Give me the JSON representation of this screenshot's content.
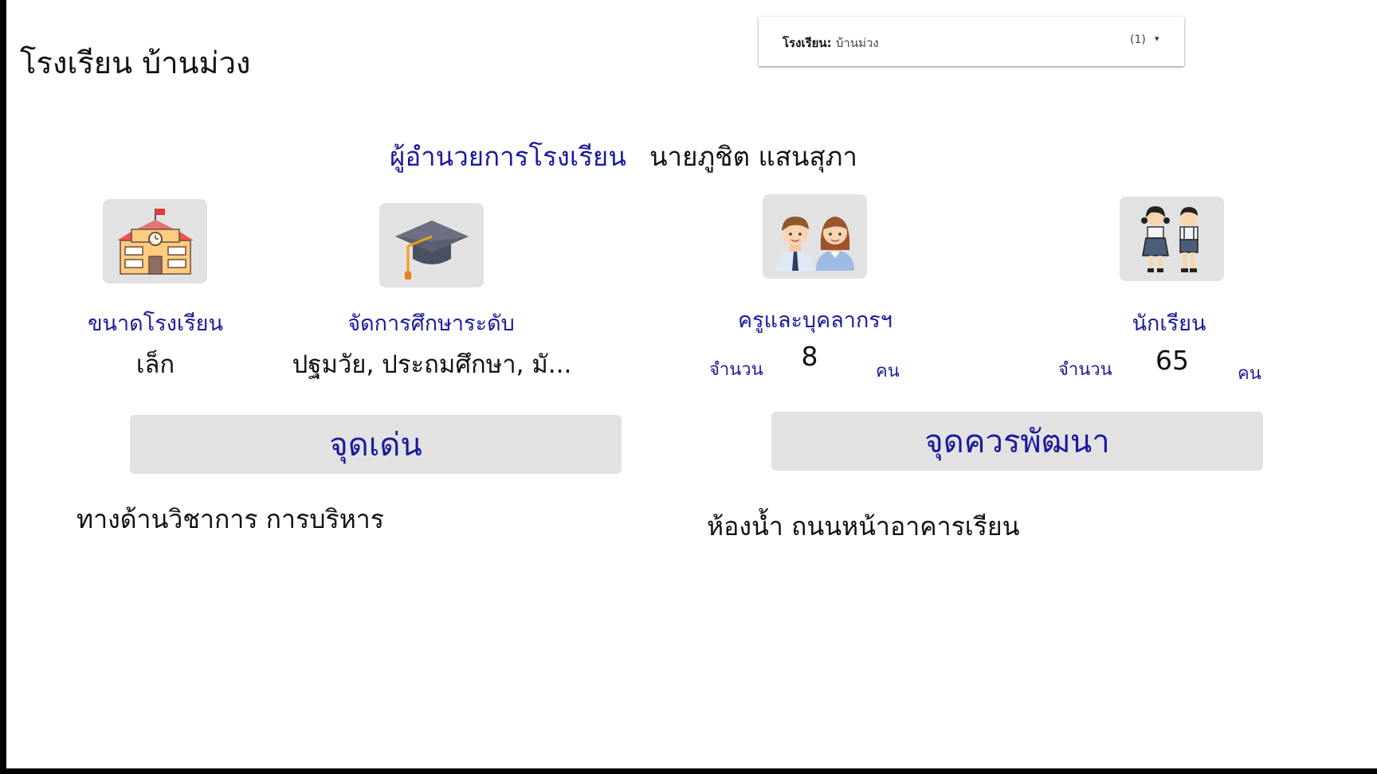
{
  "header": {
    "title": "โรงเรียน บ้านม่วง"
  },
  "filter": {
    "label": "โรงเรียน",
    "value": "บ้านม่วง",
    "count": "(1)",
    "caret": "▾"
  },
  "director": {
    "label": "ผู้อำนวยการโรงเรียน",
    "name": "นายภูชิต แสนสุภา"
  },
  "cards": {
    "size": {
      "icon": "school-building-icon",
      "label": "ขนาดโรงเรียน",
      "value": "เล็ก"
    },
    "level": {
      "icon": "graduation-cap-icon",
      "label": "จัดการศึกษาระดับ",
      "value": "ปฐมวัย, ประถมศึกษา, มั..."
    },
    "teachers": {
      "icon": "teachers-icon",
      "label": "ครูและบุคลากรฯ",
      "count_prefix": "จำนวน",
      "count": "8",
      "unit": "คน"
    },
    "students": {
      "icon": "students-icon",
      "label": "นักเรียน",
      "count_prefix": "จำนวน",
      "count": "65",
      "unit": "คน"
    }
  },
  "strengths": {
    "heading": "จุดเด่น",
    "text": "ทางด้านวิชาการ การบริหาร"
  },
  "improvements": {
    "heading": "จุดควรพัฒนา",
    "text": "ห้องน้ำ ถนนหน้าอาคารเรียน"
  },
  "colors": {
    "accent": "#1a1a9e",
    "card_bg": "#e2e2e2",
    "text": "#111111",
    "frame": "#000000"
  }
}
